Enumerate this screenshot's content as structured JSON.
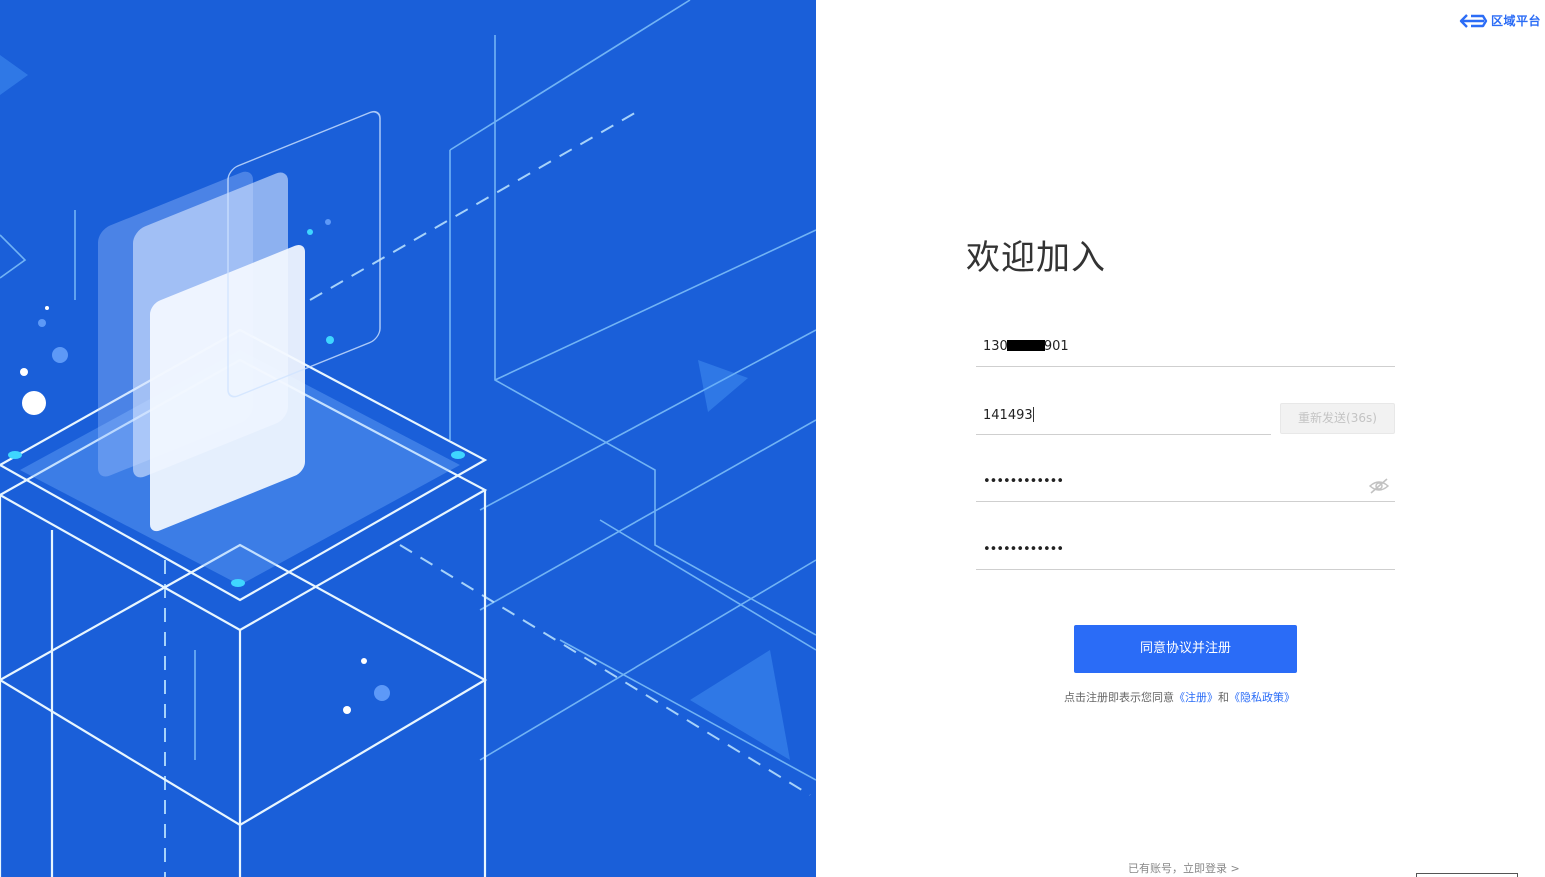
{
  "brand": {
    "name": "区域平台",
    "logo_icon": "brand-logo-icon",
    "color": "#2b6cf6"
  },
  "hero": {
    "background": "#1a5fd9",
    "image": "isometric-tech-illustration"
  },
  "form": {
    "title": "欢迎加入",
    "phone": {
      "prefix": "130",
      "suffix": "901"
    },
    "code": {
      "value": "141493"
    },
    "resend_label": "重新发送(36s)",
    "password": {
      "value": "••••••••••••",
      "toggle_icon": "eye-icon"
    },
    "confirm_password": {
      "value": "••••••••••••"
    },
    "submit_label": "同意协议并注册",
    "agreement": {
      "text": "点击注册即表示您同意",
      "register_link": "《注册》",
      "and": "和",
      "privacy_link": "《隐私政策》"
    }
  },
  "footer": {
    "login_text": "已有账号，立即登录 >"
  },
  "colors": {
    "accent": "#2a6cf7",
    "hero_blue": "#1a5fd9"
  }
}
